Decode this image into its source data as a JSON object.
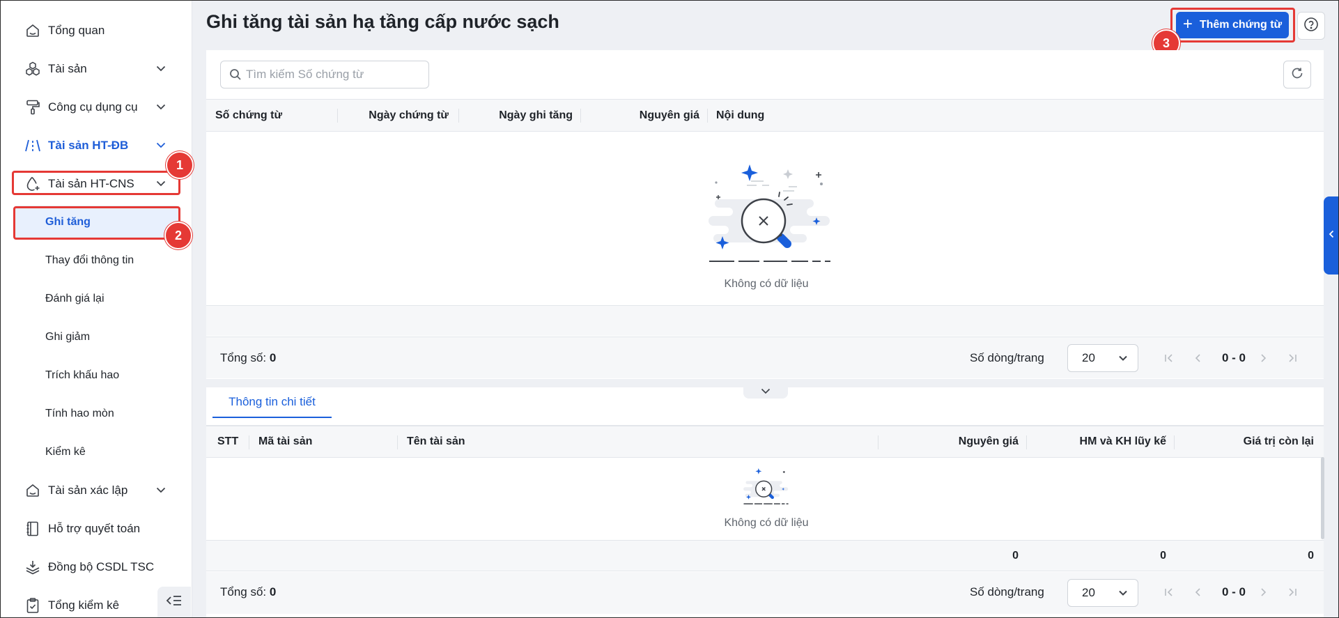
{
  "sidebar": {
    "items": [
      {
        "label": "Tổng quan",
        "icon": "home-icon"
      },
      {
        "label": "Tài sản",
        "icon": "cubes-icon"
      },
      {
        "label": "Công cụ dụng cụ",
        "icon": "paint-roller-icon"
      },
      {
        "label": "Tài sản HT-ĐB",
        "icon": "road-icon"
      },
      {
        "label": "Tài sản HT-CNS",
        "icon": "water-drop-icon"
      },
      {
        "label": "Tài sản xác lập",
        "icon": "home-icon"
      },
      {
        "label": "Hỗ trợ quyết toán",
        "icon": "book-icon"
      },
      {
        "label": "Đồng bộ CSDL TSC",
        "icon": "layers-icon"
      },
      {
        "label": "Tổng kiểm kê",
        "icon": "clipboard-icon"
      }
    ],
    "sub_items": [
      {
        "label": "Ghi tăng"
      },
      {
        "label": "Thay đổi thông tin"
      },
      {
        "label": "Đánh giá lại"
      },
      {
        "label": "Ghi giảm"
      },
      {
        "label": "Trích khấu hao"
      },
      {
        "label": "Tính hao mòn"
      },
      {
        "label": "Kiểm kê"
      }
    ]
  },
  "annotations": [
    "1",
    "2",
    "3"
  ],
  "header": {
    "title": "Ghi tăng tài sản hạ tầng cấp nước sạch",
    "add_button": "Thêm chứng từ",
    "add_icon": "+"
  },
  "search": {
    "placeholder": "Tìm kiếm Số chứng từ",
    "value": ""
  },
  "main_table": {
    "columns": [
      "Số chứng từ",
      "Ngày chứng từ",
      "Ngày ghi tăng",
      "Nguyên giá",
      "Nội dung"
    ],
    "empty_text": "Không có dữ liệu",
    "total_label": "Tổng số:",
    "total_value": "0",
    "rows_per_page_label": "Số dòng/trang",
    "rows_per_page": "20",
    "page_range": "0 - 0"
  },
  "detail": {
    "tab": "Thông tin chi tiết",
    "columns": [
      "STT",
      "Mã tài sản",
      "Tên tài sản",
      "Nguyên giá",
      "HM và KH lũy kế",
      "Giá trị còn lại"
    ],
    "empty_text": "Không có dữ liệu",
    "sums": [
      "0",
      "0",
      "0"
    ],
    "total_label": "Tổng số:",
    "total_value": "0",
    "rows_per_page_label": "Số dòng/trang",
    "rows_per_page": "20",
    "page_range": "0 - 0"
  },
  "colors": {
    "accent": "#1a5fdb",
    "annotation": "#e53935",
    "active_bg": "#e8f0fd"
  }
}
